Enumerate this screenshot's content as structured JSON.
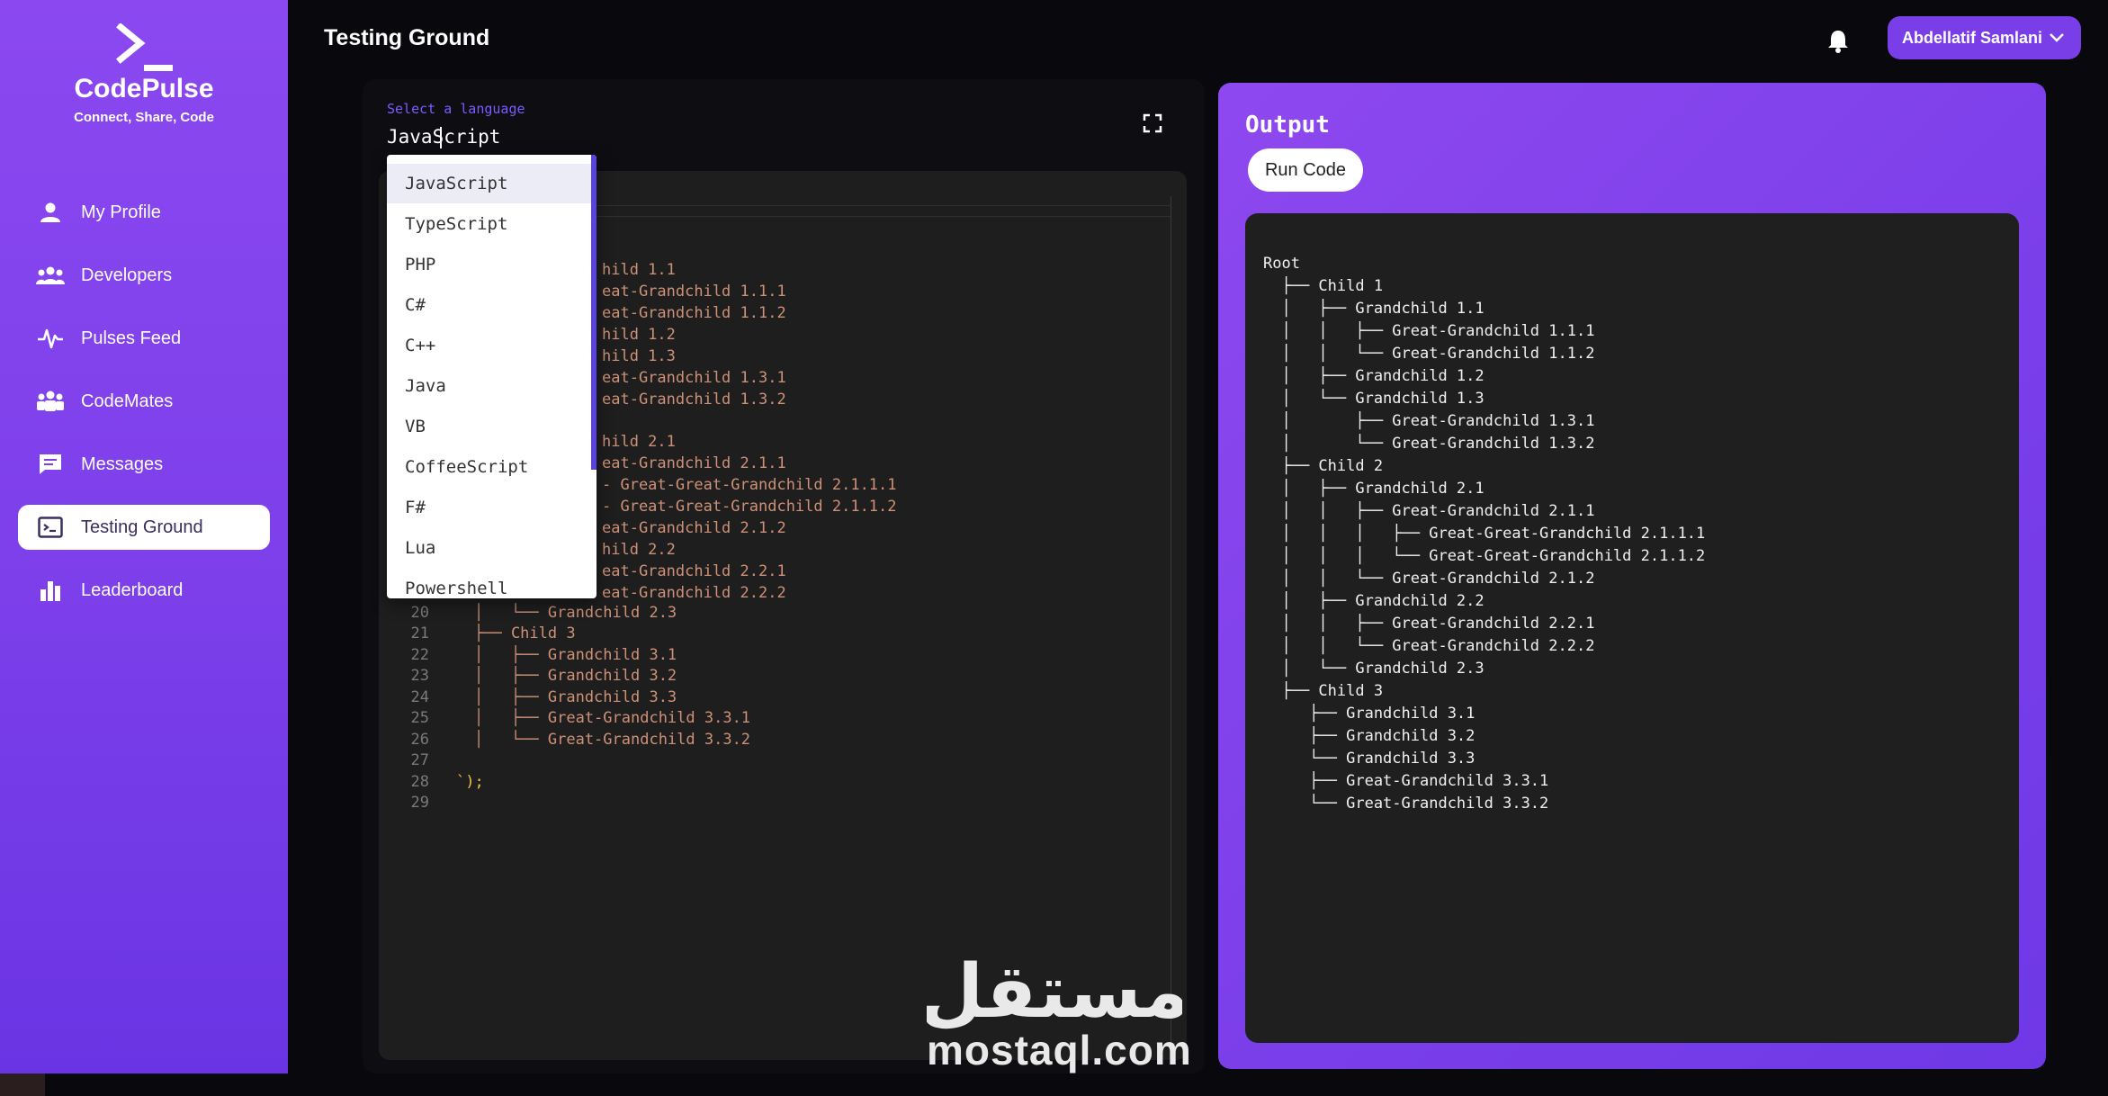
{
  "app": {
    "name": "CodePulse",
    "tagline": "Connect, Share, Code"
  },
  "sidebar": {
    "items": [
      {
        "label": "My Profile",
        "icon": "user-icon",
        "active": false
      },
      {
        "label": "Developers",
        "icon": "users-icon",
        "active": false
      },
      {
        "label": "Pulses Feed",
        "icon": "pulse-icon",
        "active": false
      },
      {
        "label": "CodeMates",
        "icon": "group-icon",
        "active": false
      },
      {
        "label": "Messages",
        "icon": "message-icon",
        "active": false
      },
      {
        "label": "Testing Ground",
        "icon": "terminal-icon",
        "active": true
      },
      {
        "label": "Leaderboard",
        "icon": "bar-chart-icon",
        "active": false
      }
    ]
  },
  "header": {
    "title": "Testing Ground",
    "user_name": "Abdellatif Samlani"
  },
  "editor": {
    "language_label": "Select a language",
    "language_value": "JavaScript",
    "line_numbers": [
      "20",
      "21",
      "22",
      "23",
      "24",
      "25",
      "26",
      "27",
      "28",
      "29"
    ],
    "visible_fragments": [
      "hild 1.1",
      "eat-Grandchild 1.1.1",
      "eat-Grandchild 1.1.2",
      "hild 1.2",
      "hild 1.3",
      "eat-Grandchild 1.3.1",
      "eat-Grandchild 1.3.2",
      "hild 2.1",
      "eat-Grandchild 2.1.1",
      "- Great-Great-Grandchild 2.1.1.1",
      "- Great-Great-Grandchild 2.1.1.2",
      "eat-Grandchild 2.1.2",
      "hild 2.2",
      "eat-Grandchild 2.2.1",
      "eat-Grandchild 2.2.2"
    ],
    "lines": [
      "│   └── Grandchild 2.3",
      "├── Child 3",
      "│   ├── Grandchild 3.1",
      "│   ├── Grandchild 3.2",
      "│   ├── Grandchild 3.3",
      "│   ├── Great-Grandchild 3.3.1",
      "│   └── Great-Grandchild 3.3.2",
      "",
      "`);",
      ""
    ]
  },
  "language_dropdown": {
    "options": [
      "JavaScript",
      "TypeScript",
      "PHP",
      "C#",
      "C++",
      "Java",
      "VB",
      "CoffeeScript",
      "F#",
      "Lua",
      "Powershell"
    ],
    "selected": "JavaScript"
  },
  "output": {
    "title": "Output",
    "run_label": "Run Code",
    "lines": [
      "Root",
      "  ├── Child 1",
      "  │   ├── Grandchild 1.1",
      "  │   │   ├── Great-Grandchild 1.1.1",
      "  │   │   └── Great-Grandchild 1.1.2",
      "  │   ├── Grandchild 1.2",
      "  │   └── Grandchild 1.3",
      "  │       ├── Great-Grandchild 1.3.1",
      "  │       └── Great-Grandchild 1.3.2",
      "  ├── Child 2",
      "  │   ├── Grandchild 2.1",
      "  │   │   ├── Great-Grandchild 2.1.1",
      "  │   │   │   ├── Great-Great-Grandchild 2.1.1.1",
      "  │   │   │   └── Great-Great-Grandchild 2.1.1.2",
      "  │   │   └── Great-Grandchild 2.1.2",
      "  │   ├── Grandchild 2.2",
      "  │   │   ├── Great-Grandchild 2.2.1",
      "  │   │   └── Great-Grandchild 2.2.2",
      "  │   └── Grandchild 2.3",
      "  ├── Child 3",
      "     ├── Grandchild 3.1",
      "     ├── Grandchild 3.2",
      "     └── Grandchild 3.3",
      "     ├── Great-Grandchild 3.3.1",
      "     └── Great-Grandchild 3.3.2"
    ]
  },
  "watermark": {
    "arabic": "مستقل",
    "latin": "mostaql.com"
  },
  "colors": {
    "sidebar": "#7c3fea",
    "accent": "#7a3ee8",
    "code_string": "#ce9178",
    "code_bg": "#1e1e1e"
  }
}
